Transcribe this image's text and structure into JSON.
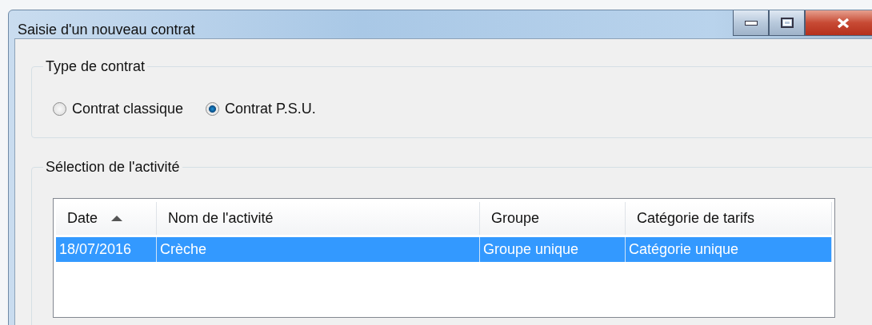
{
  "window": {
    "title": "Saisie d'un nouveau contrat"
  },
  "contract_type": {
    "legend": "Type de contrat",
    "options": [
      {
        "label": "Contrat classique",
        "selected": false
      },
      {
        "label": "Contrat P.S.U.",
        "selected": true
      }
    ]
  },
  "activity": {
    "legend": "Sélection de l'activité",
    "table": {
      "columns": [
        {
          "label": "Date",
          "sorted": true
        },
        {
          "label": "Nom de l'activité",
          "sorted": false
        },
        {
          "label": "Groupe",
          "sorted": false
        },
        {
          "label": "Catégorie de tarifs",
          "sorted": false
        }
      ],
      "rows": [
        {
          "cells": [
            "18/07/2016",
            "Crèche",
            "Groupe unique",
            "Catégorie unique"
          ],
          "selected": true
        }
      ]
    }
  }
}
